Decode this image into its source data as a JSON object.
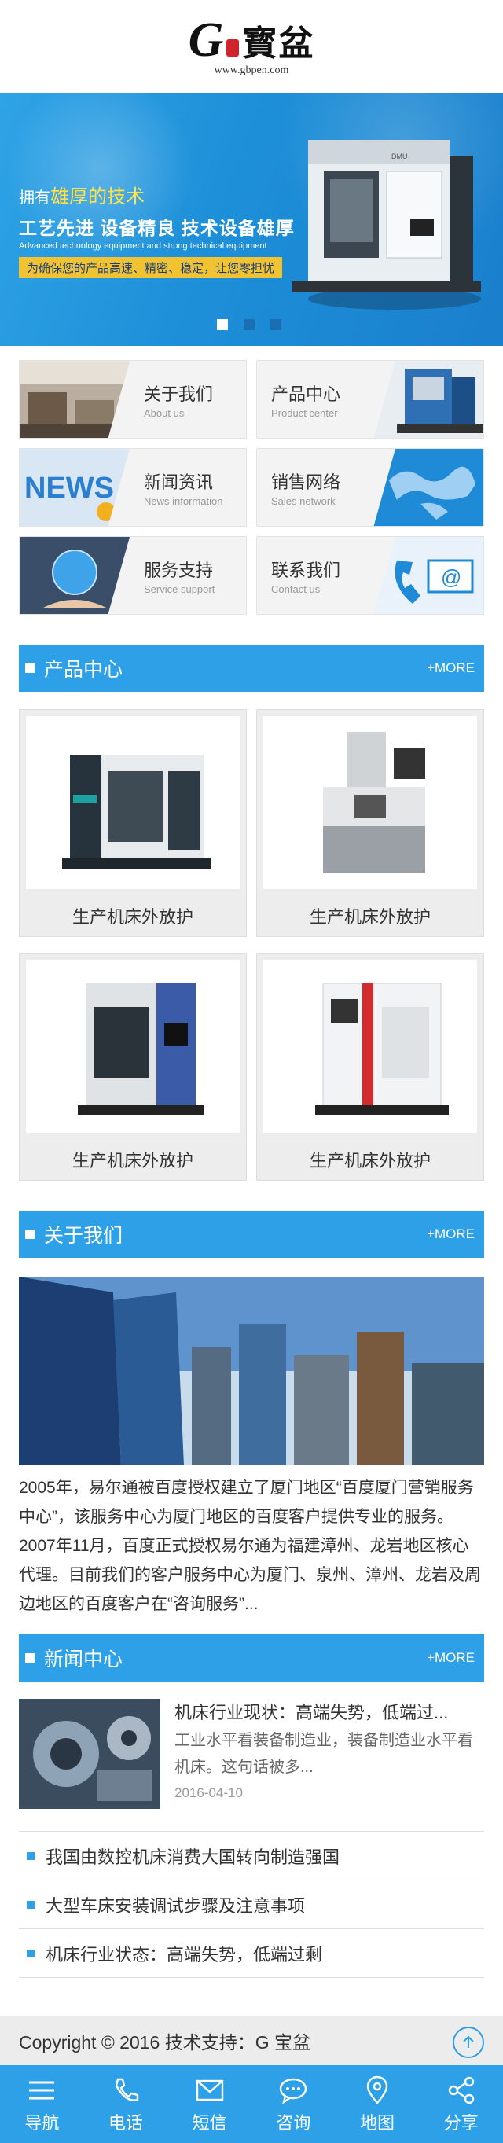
{
  "logo": {
    "letter": "G",
    "name": "寳盆",
    "url": "www.gbpen.com"
  },
  "banner": {
    "line1_prefix": "拥有",
    "line1_highlight": "雄厚的技术",
    "line2": "工艺先进  设备精良  技术设备雄厚",
    "line3": "Advanced technology equipment and strong technical equipment",
    "line4": "为确保您的产品高速、精密、稳定，让您零担忧",
    "slides": 3,
    "active_slide": 1
  },
  "quicknav": [
    {
      "title": "关于我们",
      "sub": "About us",
      "icon": "office-photo"
    },
    {
      "title": "产品中心",
      "sub": "Product center",
      "icon": "machine-photo"
    },
    {
      "title": "新闻资讯",
      "sub": "News information",
      "icon": "news-3d-photo"
    },
    {
      "title": "销售网络",
      "sub": "Sales network",
      "icon": "world-map-photo"
    },
    {
      "title": "服务支持",
      "sub": "Service support",
      "icon": "globe-hand-photo"
    },
    {
      "title": "联系我们",
      "sub": "Contact us",
      "icon": "phone-email-photo"
    }
  ],
  "sections": {
    "products": {
      "title": "产品中心",
      "more": "+MORE"
    },
    "about": {
      "title": "关于我们",
      "more": "+MORE"
    },
    "news": {
      "title": "新闻中心",
      "more": "+MORE"
    }
  },
  "products": [
    {
      "name": "生产机床外放护"
    },
    {
      "name": "生产机床外放护"
    },
    {
      "name": "生产机床外放护"
    },
    {
      "name": "生产机床外放护"
    }
  ],
  "about_text": "2005年，易尔通被百度授权建立了厦门地区“百度厦门营销服务中心”，该服务中心为厦门地区的百度客户提供专业的服务。2007年11月，百度正式授权易尔通为福建漳州、龙岩地区核心代理。目前我们的客户服务中心为厦门、泉州、漳州、龙岩及周边地区的百度客户在“咨询服务”...",
  "news_feature": {
    "title": "机床行业现状：高端失势，低端过...",
    "desc": "工业水平看装备制造业，装备制造业水平看机床。这句话被多...",
    "date": "2016-04-10"
  },
  "news_list": [
    "我国由数控机床消费大国转向制造强国",
    "大型车床安装调试步骤及注意事项",
    "机床行业状态：高端失势，低端过剩"
  ],
  "footer": {
    "text": "Copyright © 2016  技术支持：G 宝盆"
  },
  "bottom_nav": [
    {
      "label": "导航",
      "icon": "menu-icon"
    },
    {
      "label": "电话",
      "icon": "phone-icon"
    },
    {
      "label": "短信",
      "icon": "message-icon"
    },
    {
      "label": "咨询",
      "icon": "chat-icon"
    },
    {
      "label": "地图",
      "icon": "location-icon"
    },
    {
      "label": "分享",
      "icon": "share-icon"
    }
  ],
  "colors": {
    "accent": "#2da0e8",
    "banner": "#1d8fd8",
    "highlight": "#ffe14a"
  }
}
